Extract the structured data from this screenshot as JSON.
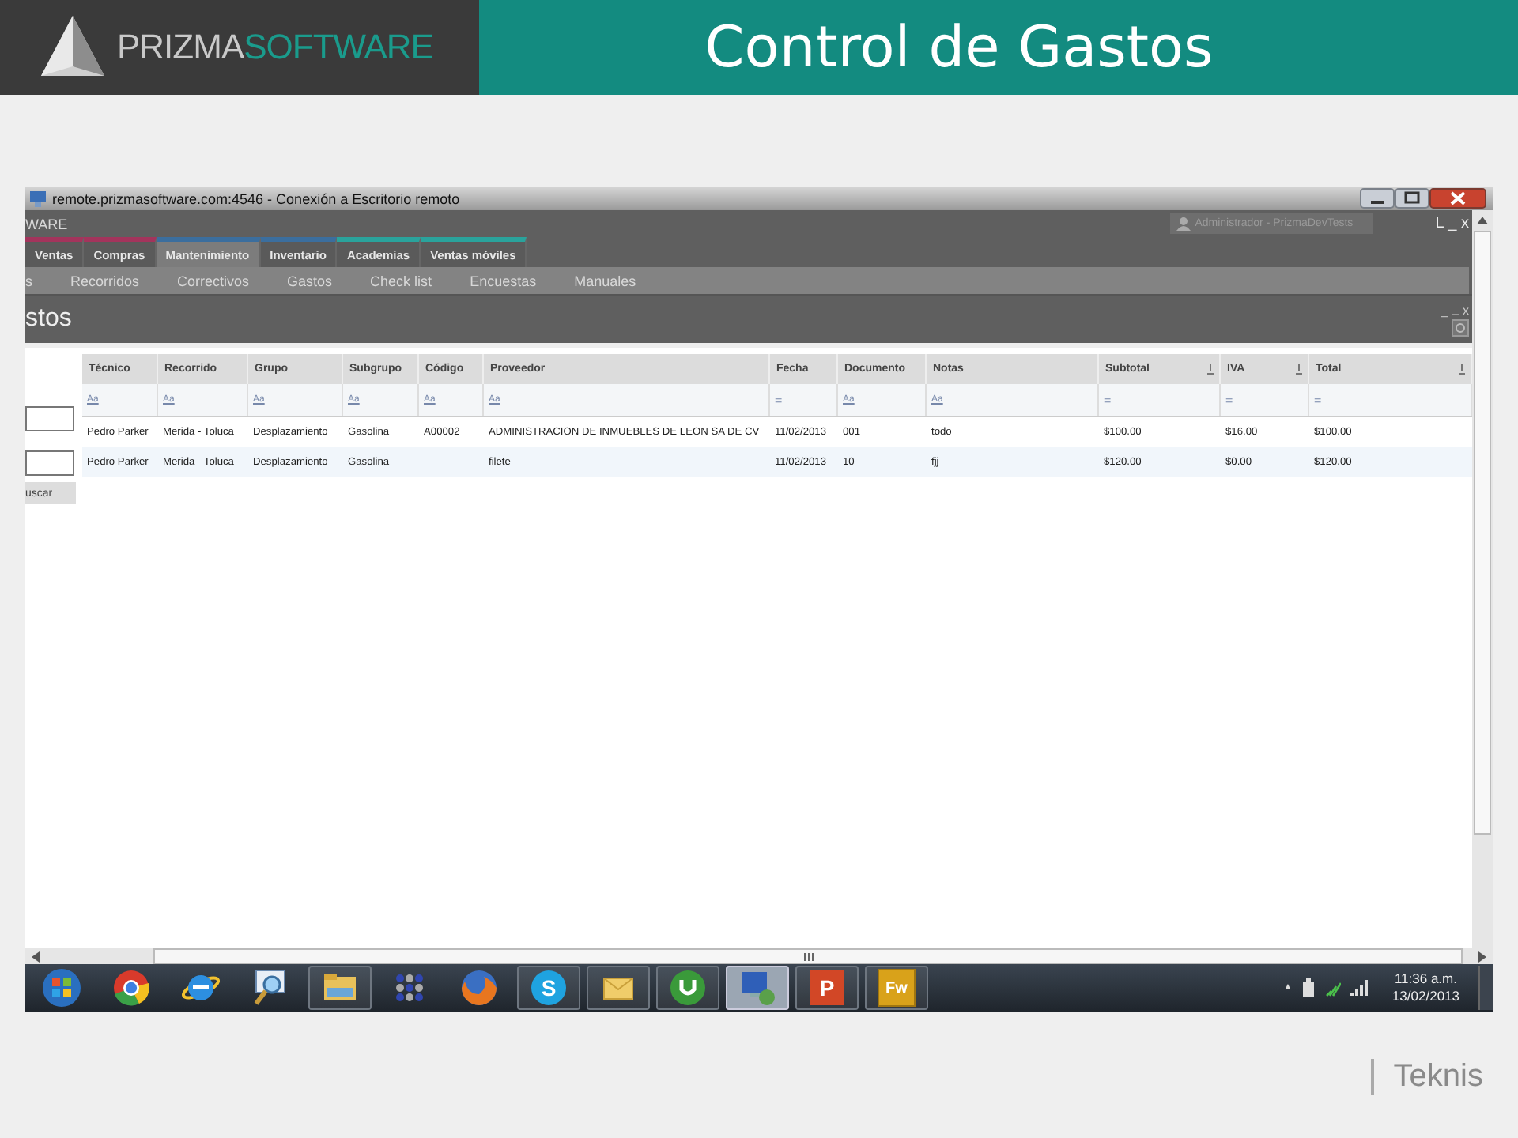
{
  "slide": {
    "logo": {
      "part1": "PRIZMA",
      "part2": "SOFTWARE"
    },
    "title": "Control de Gastos",
    "footer": "Teknis"
  },
  "window": {
    "title": "remote.prizmasoftware.com:4546 - Conexión a Escritorio remoto"
  },
  "app": {
    "brand": "WARE",
    "user": "Administrador - PrizmaDevTests",
    "user_controls": "L _ x",
    "tabs": [
      {
        "label": "Ventas",
        "selected": false,
        "color": "#a3345c"
      },
      {
        "label": "Compras",
        "selected": false,
        "color": "#a3345c"
      },
      {
        "label": "Mantenimiento",
        "selected": true,
        "color": "#3b6e9e"
      },
      {
        "label": "Inventario",
        "selected": false,
        "color": "#3b6e9e"
      },
      {
        "label": "Academias",
        "selected": false,
        "color": "#2aa39c"
      },
      {
        "label": "Ventas móviles",
        "selected": false,
        "color": "#2aa39c"
      }
    ],
    "subnav": [
      "s",
      "Recorridos",
      "Correctivos",
      "Gastos",
      "Check list",
      "Encuestas",
      "Manuales"
    ],
    "heading": "stos",
    "heading_controls": "_ □ x",
    "search_button": "uscar",
    "table": {
      "columns": [
        {
          "label": "Técnico",
          "filter": "Aa",
          "sortable": false
        },
        {
          "label": "Recorrido",
          "filter": "Aa",
          "sortable": false
        },
        {
          "label": "Grupo",
          "filter": "Aa",
          "sortable": false
        },
        {
          "label": "Subgrupo",
          "filter": "Aa",
          "sortable": false
        },
        {
          "label": "Código",
          "filter": "Aa",
          "sortable": false
        },
        {
          "label": "Proveedor",
          "filter": "Aa",
          "sortable": false
        },
        {
          "label": "Fecha",
          "filter": "=",
          "sortable": false
        },
        {
          "label": "Documento",
          "filter": "Aa",
          "sortable": false
        },
        {
          "label": "Notas",
          "filter": "Aa",
          "sortable": false
        },
        {
          "label": "Subtotal",
          "filter": "=",
          "sortable": true
        },
        {
          "label": "IVA",
          "filter": "=",
          "sortable": true
        },
        {
          "label": "Total",
          "filter": "=",
          "sortable": true
        }
      ],
      "rows": [
        [
          "Pedro Parker",
          "Merida - Toluca",
          "Desplazamiento",
          "Gasolina",
          "A00002",
          "ADMINISTRACION DE INMUEBLES DE LEON SA DE CV",
          "11/02/2013",
          "001",
          "todo",
          "$100.00",
          "$16.00",
          "$100.00"
        ],
        [
          "Pedro Parker",
          "Merida - Toluca",
          "Desplazamiento",
          "Gasolina",
          "",
          "filete",
          "11/02/2013",
          "10",
          "fjj",
          "$120.00",
          "$0.00",
          "$120.00"
        ]
      ]
    }
  },
  "taskbar": {
    "apps": [
      {
        "kind": "start",
        "running": false,
        "selected": false
      },
      {
        "kind": "chrome",
        "running": false,
        "selected": false
      },
      {
        "kind": "ie",
        "running": false,
        "selected": false
      },
      {
        "kind": "magnifier",
        "running": false,
        "selected": false
      },
      {
        "kind": "folder",
        "running": true,
        "selected": false
      },
      {
        "kind": "dots",
        "running": false,
        "selected": false
      },
      {
        "kind": "firefox",
        "running": false,
        "selected": false
      },
      {
        "kind": "skype",
        "label": "S",
        "running": true,
        "selected": false
      },
      {
        "kind": "outlook",
        "running": true,
        "selected": false
      },
      {
        "kind": "utorrent",
        "running": true,
        "selected": false
      },
      {
        "kind": "remote",
        "running": true,
        "selected": true
      },
      {
        "kind": "powerpoint",
        "label": "P",
        "running": true,
        "selected": false
      },
      {
        "kind": "fireworks",
        "label": "Fw",
        "running": true,
        "selected": false
      }
    ],
    "tray_toggle": "▲",
    "time": "11:36 a.m.",
    "date": "13/02/2013"
  }
}
